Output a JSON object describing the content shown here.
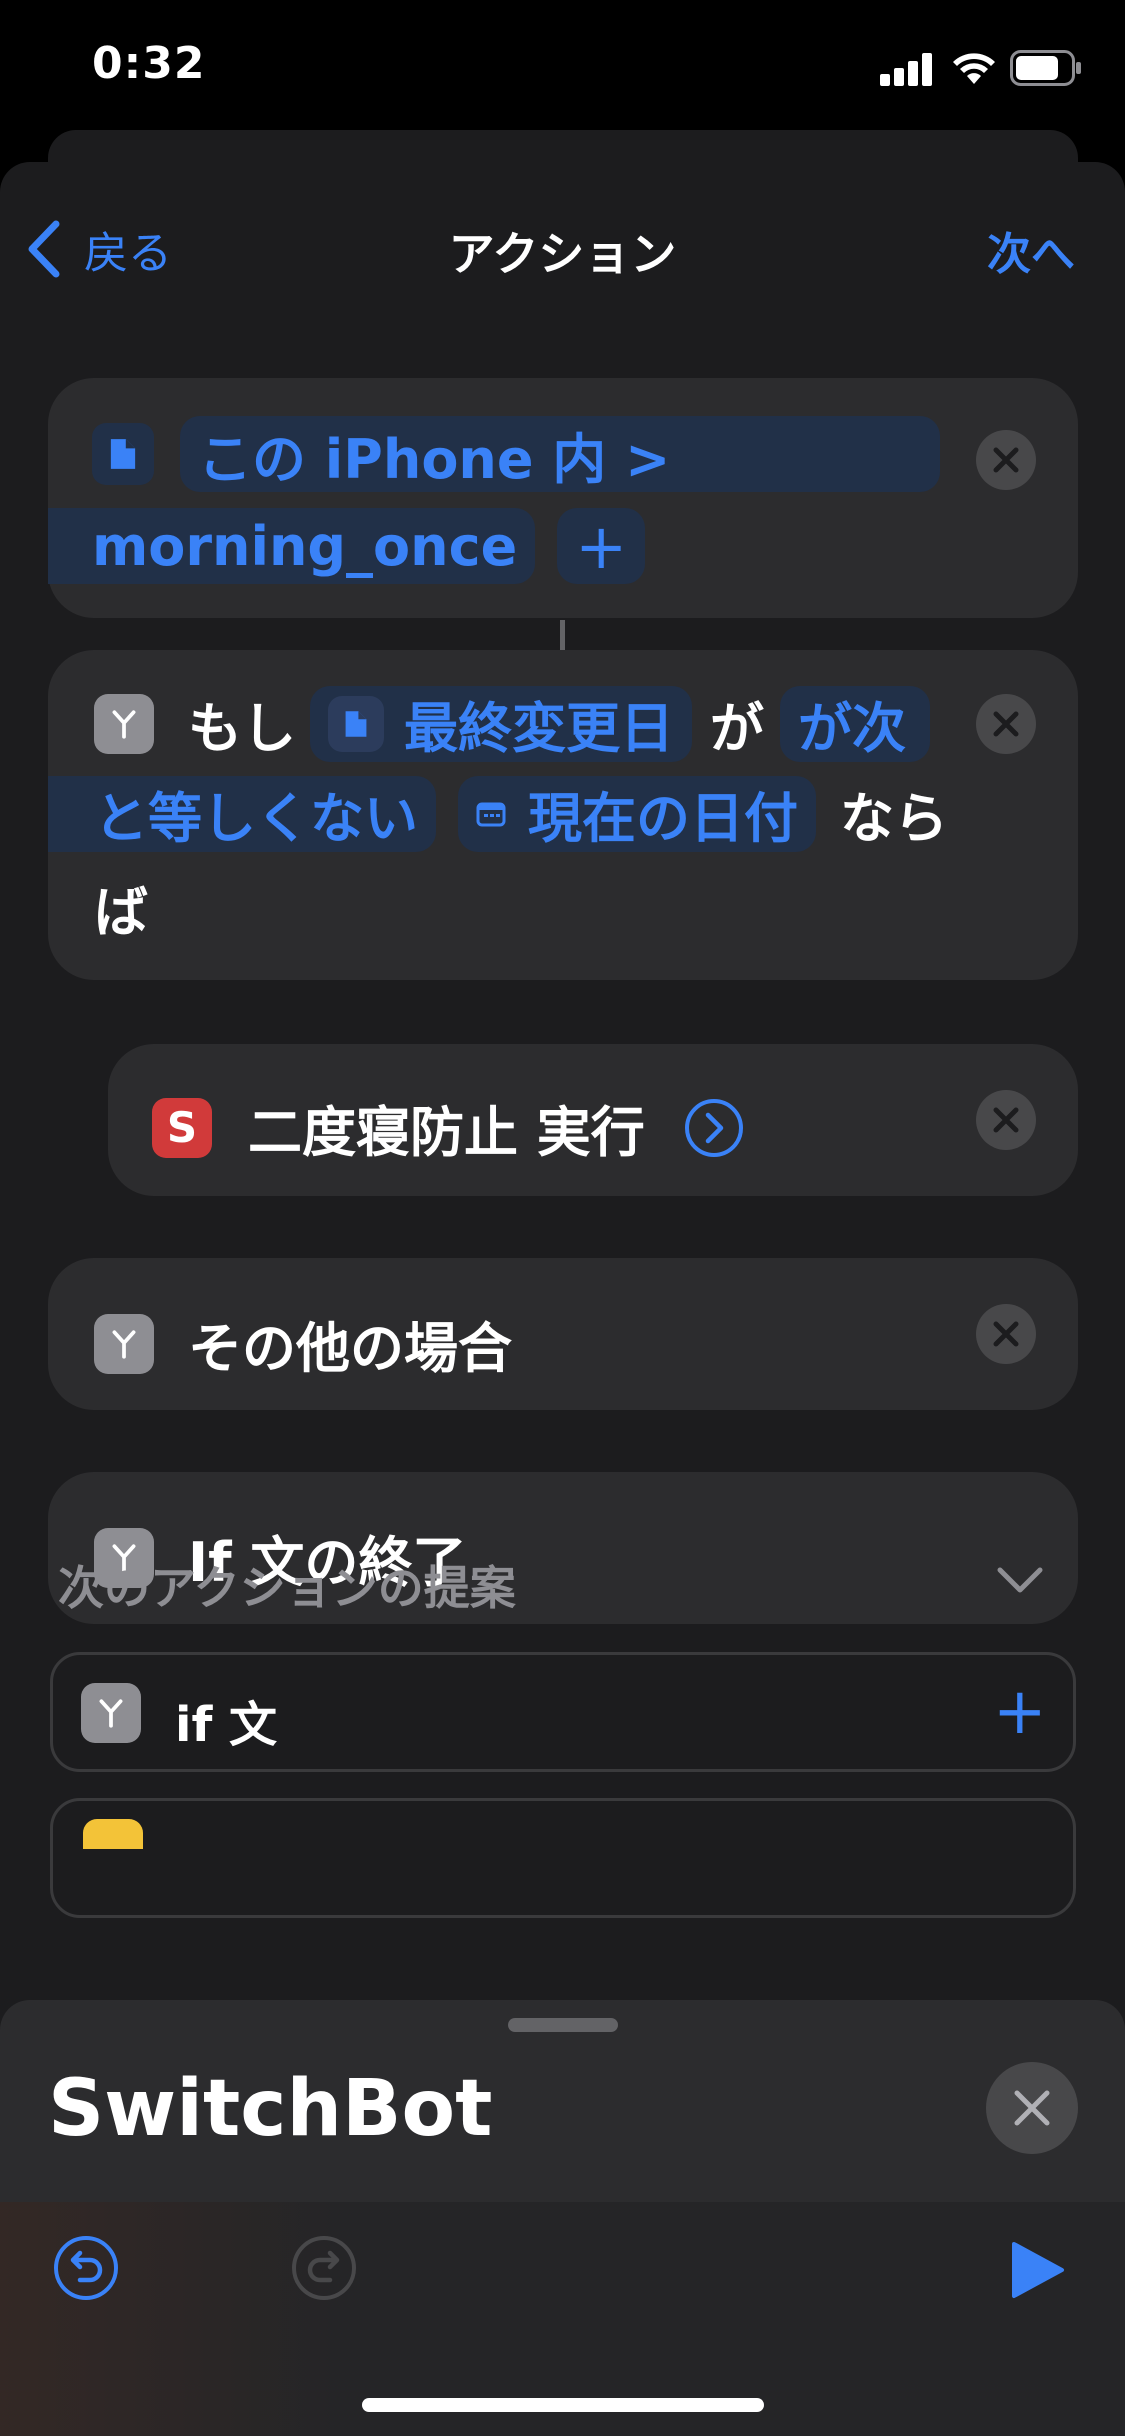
{
  "status": {
    "time": "0:32"
  },
  "nav": {
    "back_label": "戻る",
    "title": "アクション",
    "next_label": "次へ"
  },
  "file_action": {
    "location_token": "この iPhone 内 >",
    "filename_token": "morning_once",
    "add_symbol": "+"
  },
  "if_action": {
    "prefix": "もし",
    "variable_token": "最終変更日",
    "particle": "が",
    "condition_token_part1": "が次",
    "condition_token_part2": "と等しくない",
    "value_token": "現在の日付",
    "suffix_part1": "なら",
    "suffix_part2": "ば"
  },
  "run_action": {
    "label": "二度寝防止 実行"
  },
  "otherwise_action": {
    "label": "その他の場合"
  },
  "endif_action": {
    "label": "If 文の終了"
  },
  "suggestions": {
    "header": "次のアクションの提案",
    "items": [
      {
        "label": "if 文",
        "add_symbol": "+"
      }
    ]
  },
  "bottom_panel": {
    "title": "SwitchBot"
  },
  "colors": {
    "accent": "#3a82f7",
    "card": "#2c2c2e",
    "sheet": "#1c1c1e",
    "token_bg": "#213048",
    "shortcut_red": "#d13a3a"
  },
  "icons": [
    "chevron-left-icon",
    "file-icon",
    "close-icon",
    "branch-icon",
    "calendar-icon",
    "shortcut-s-icon",
    "chevron-right-circle-icon",
    "chevron-down-icon",
    "undo-icon",
    "redo-icon",
    "play-icon"
  ]
}
